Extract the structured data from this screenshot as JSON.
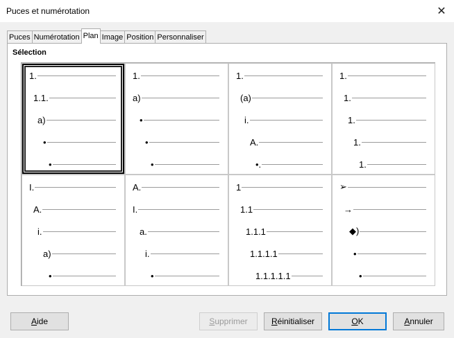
{
  "window": {
    "title": "Puces et numérotation",
    "close_glyph": "✕"
  },
  "tabs": [
    {
      "label": "Puces",
      "active": false
    },
    {
      "label": "Numérotation",
      "active": false
    },
    {
      "label": "Plan",
      "active": true
    },
    {
      "label": "Image",
      "active": false
    },
    {
      "label": "Position",
      "active": false
    },
    {
      "label": "Personnaliser",
      "active": false
    }
  ],
  "section": {
    "title": "Sélection"
  },
  "presets": [
    {
      "selected": true,
      "lines": [
        "1.",
        "1.1.",
        "a)",
        "•",
        "•"
      ]
    },
    {
      "selected": false,
      "lines": [
        "1.",
        "a)",
        "•",
        "•",
        "•"
      ]
    },
    {
      "selected": false,
      "lines": [
        "1.",
        "(a)",
        "i.",
        "A.",
        "•."
      ]
    },
    {
      "selected": false,
      "lines": [
        "1.",
        "1.",
        "1.",
        "1.",
        "1."
      ]
    },
    {
      "selected": false,
      "lines": [
        "I.",
        "A.",
        "i.",
        "a)",
        "•"
      ]
    },
    {
      "selected": false,
      "lines": [
        "A.",
        "I.",
        "a.",
        "i.",
        "•"
      ]
    },
    {
      "selected": false,
      "lines": [
        "1",
        "1.1",
        "1.1.1",
        "1.1.1.1",
        "1.1.1.1.1"
      ]
    },
    {
      "selected": false,
      "lines": [
        "➢",
        "→",
        "◆)",
        "•",
        "•"
      ]
    }
  ],
  "buttons": {
    "help": {
      "label": "Aide",
      "mnemonic": "A"
    },
    "delete": {
      "label": "Supprimer",
      "mnemonic": "S",
      "enabled": false
    },
    "reset": {
      "label": "Réinitialiser",
      "mnemonic": "R"
    },
    "ok": {
      "label": "OK",
      "mnemonic": "O",
      "default": true
    },
    "cancel": {
      "label": "Annuler",
      "mnemonic": "A"
    }
  },
  "colors": {
    "dialog_bg": "#f0f0f0",
    "default_button_border": "#0078d7"
  }
}
